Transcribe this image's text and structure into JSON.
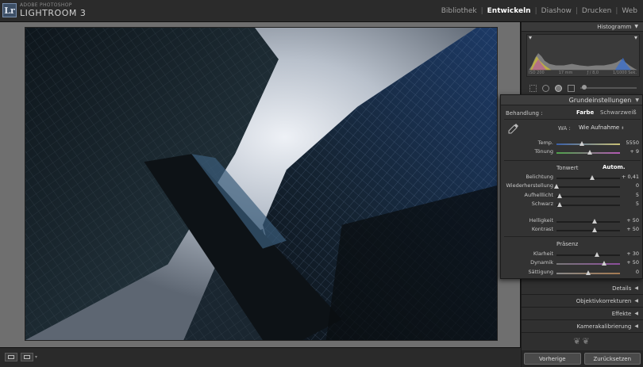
{
  "app": {
    "brand_small": "ADOBE PHOTOSHOP",
    "brand_big": "LIGHTROOM 3",
    "logo": "Lr"
  },
  "modules": [
    {
      "label": "Bibliothek",
      "active": false
    },
    {
      "label": "Entwickeln",
      "active": true
    },
    {
      "label": "Diashow",
      "active": false
    },
    {
      "label": "Drucken",
      "active": false
    },
    {
      "label": "Web",
      "active": false
    }
  ],
  "histogram": {
    "title": "Histogramm",
    "iso": "ISO 200",
    "focal": "17 mm",
    "aperture": "ƒ / 8,0",
    "shutter": "1/1000 Sek."
  },
  "basic": {
    "title": "Grundeinstellungen",
    "treatment_label": "Behandlung :",
    "treatment_color": "Farbe",
    "treatment_bw": "Schwarzweiß",
    "wb_label": "WA :",
    "wb_value": "Wie Aufnahme",
    "temp": {
      "label": "Temp.",
      "value": "5550",
      "pos": 0.4
    },
    "tint": {
      "label": "Tönung",
      "value": "+ 9",
      "pos": 0.52
    },
    "tone_title": "Tonwert",
    "tone_auto": "Autom.",
    "exposure": {
      "label": "Belichtung",
      "value": "+ 0,41",
      "pos": 0.56
    },
    "recovery": {
      "label": "Wiederherstellung",
      "value": "0",
      "pos": 0.0
    },
    "fill": {
      "label": "Aufhelllicht",
      "value": "5",
      "pos": 0.05
    },
    "blacks": {
      "label": "Schwarz",
      "value": "5",
      "pos": 0.05
    },
    "brightness": {
      "label": "Helligkeit",
      "value": "+ 50",
      "pos": 0.6
    },
    "contrast": {
      "label": "Kontrast",
      "value": "+ 50",
      "pos": 0.6
    },
    "presence_title": "Präsenz",
    "clarity": {
      "label": "Klarheit",
      "value": "+ 30",
      "pos": 0.64
    },
    "vibrance": {
      "label": "Dynamik",
      "value": "+ 50",
      "pos": 0.75
    },
    "saturation": {
      "label": "Sättigung",
      "value": "0",
      "pos": 0.5
    }
  },
  "panels": {
    "details": "Details",
    "lens": "Objektivkorrekturen",
    "effects": "Effekte",
    "camera": "Kamerakalibrierung"
  },
  "footer": {
    "previous": "Vorherige",
    "reset": "Zurücksetzen"
  },
  "icons": {
    "logo": "lr-logo-icon",
    "eyedropper": "eyedropper-icon",
    "collapse": "triangle-down-icon",
    "expand": "triangle-left-icon"
  }
}
